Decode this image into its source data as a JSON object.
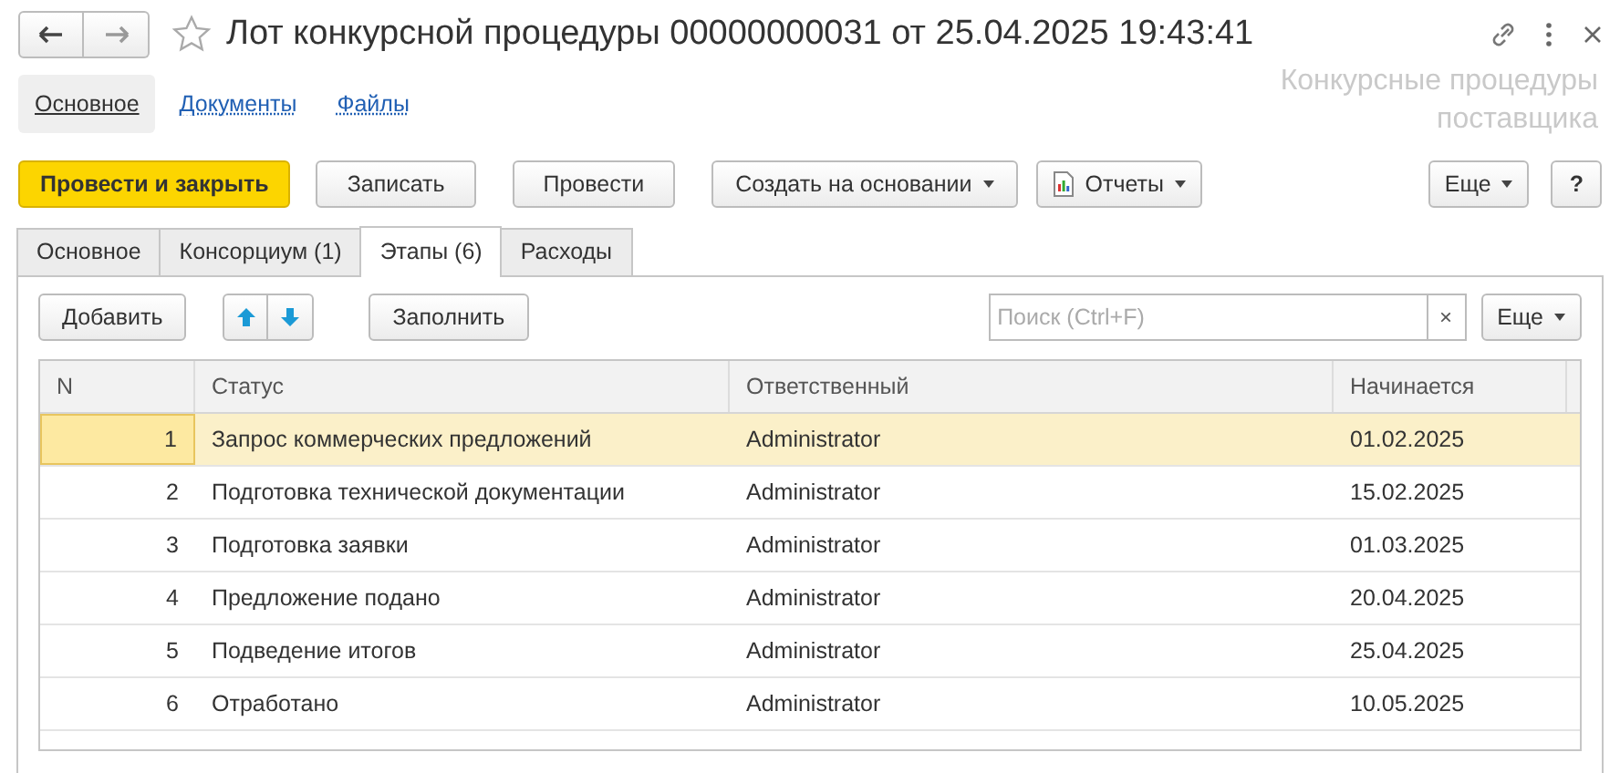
{
  "window": {
    "title": "Лот конкурсной процедуры 00000000031 от 25.04.2025 19:43:41",
    "starred": false
  },
  "nav": {
    "items": [
      {
        "label": "Основное",
        "selected": true
      },
      {
        "label": "Документы",
        "selected": false
      },
      {
        "label": "Файлы",
        "selected": false
      }
    ],
    "section_title": "Конкурсные процедуры поставщика"
  },
  "command_bar": {
    "buttons": [
      {
        "label": "Провести и закрыть",
        "kind": "primary"
      },
      {
        "label": "Записать",
        "kind": "plain"
      },
      {
        "label": "Провести",
        "kind": "plain"
      },
      {
        "label": "Создать на основании",
        "kind": "dropdown"
      },
      {
        "label": "Отчеты",
        "kind": "report"
      }
    ],
    "more": "Еще",
    "help": "?"
  },
  "tabs": [
    {
      "label": "Основное",
      "selected": false
    },
    {
      "label": "Консорциум (1)",
      "selected": false
    },
    {
      "label": "Этапы (6)",
      "selected": true
    },
    {
      "label": "Расходы",
      "selected": false
    }
  ],
  "table_toolbar": {
    "add": "Добавить",
    "fill": "Заполнить",
    "search": {
      "placeholder": "Поиск (Ctrl+F)"
    },
    "clear": "×",
    "more": "Еще"
  },
  "table": {
    "columns": [
      "N",
      "Статус",
      "Ответственный",
      "Начинается"
    ],
    "rows": [
      {
        "cells": [
          "1",
          "Запрос коммерческих предложений",
          "Administrator",
          "01.02.2025"
        ],
        "selected": true
      },
      {
        "cells": [
          "2",
          "Подготовка технической документации",
          "Administrator",
          "15.02.2025"
        ],
        "selected": false
      },
      {
        "cells": [
          "3",
          "Подготовка заявки",
          "Administrator",
          "01.03.2025"
        ],
        "selected": false
      },
      {
        "cells": [
          "4",
          "Предложение подано",
          "Administrator",
          "20.04.2025"
        ],
        "selected": false
      },
      {
        "cells": [
          "5",
          "Подведение итогов",
          "Administrator",
          "25.04.2025"
        ],
        "selected": false
      },
      {
        "cells": [
          "6",
          "Отработано",
          "Administrator",
          "10.05.2025"
        ],
        "selected": false
      }
    ]
  }
}
